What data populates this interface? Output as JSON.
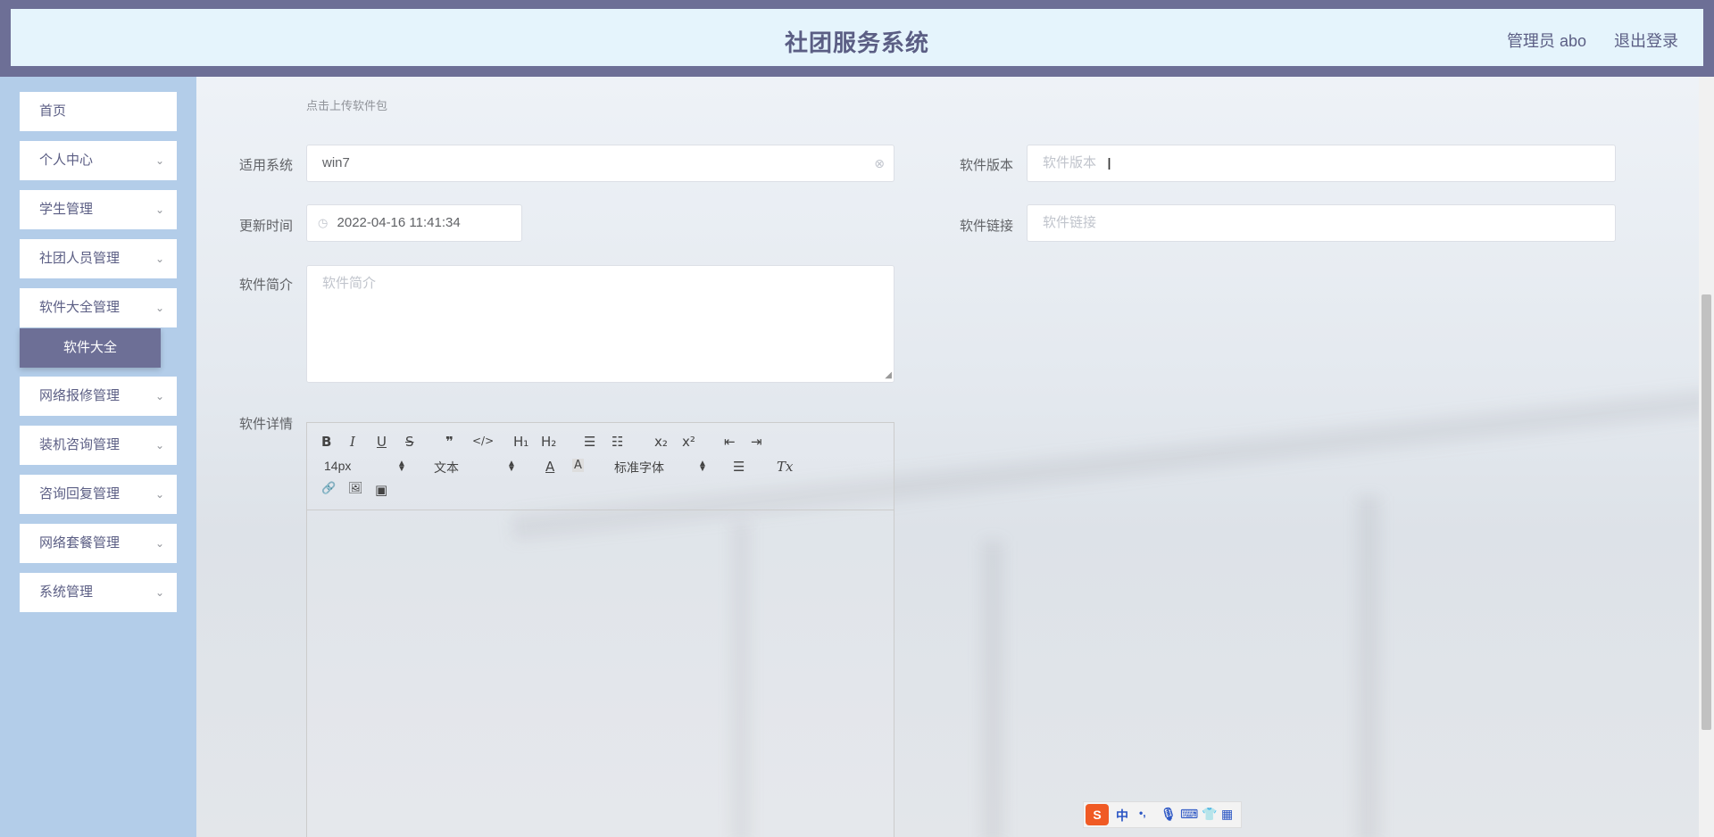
{
  "header": {
    "title": "社团服务系统",
    "user": "管理员 abo",
    "logout": "退出登录"
  },
  "sidebar": {
    "items": [
      {
        "label": "首页",
        "expandable": false
      },
      {
        "label": "个人中心",
        "expandable": true
      },
      {
        "label": "学生管理",
        "expandable": true
      },
      {
        "label": "社团人员管理",
        "expandable": true
      },
      {
        "label": "软件大全管理",
        "expandable": true
      },
      {
        "label": "网络报修管理",
        "expandable": true
      },
      {
        "label": "装机咨询管理",
        "expandable": true
      },
      {
        "label": "咨询回复管理",
        "expandable": true
      },
      {
        "label": "网络套餐管理",
        "expandable": true
      },
      {
        "label": "系统管理",
        "expandable": true
      }
    ],
    "submenu_active": "软件大全",
    "chevron_glyph": "⌄"
  },
  "form": {
    "upload_tip": "点击上传软件包",
    "system": {
      "label": "适用系统",
      "value": "win7"
    },
    "version": {
      "label": "软件版本",
      "placeholder": "软件版本"
    },
    "update_time": {
      "label": "更新时间",
      "value": "2022-04-16 11:41:34"
    },
    "link": {
      "label": "软件链接",
      "placeholder": "软件链接"
    },
    "intro": {
      "label": "软件简介",
      "placeholder": "软件简介"
    },
    "detail": {
      "label": "软件详情"
    }
  },
  "editor": {
    "buttons": {
      "bold": "B",
      "italic": "I",
      "underline": "U",
      "strike": "S",
      "quote": "❞",
      "code": "</>",
      "h1": "H₁",
      "h2": "H₂",
      "ordered": "☰",
      "bullet": "☷",
      "sub": "x₂",
      "sup": "x²",
      "outdent": "⇤",
      "indent": "⇥",
      "color": "A",
      "background": "A",
      "align": "☰",
      "clean": "Tx",
      "link": "🔗",
      "image": "🖼",
      "video": "▣"
    },
    "size": "14px",
    "header": "文本",
    "font": "标准字体"
  },
  "ime": {
    "mode": "中",
    "punct": "•,"
  }
}
